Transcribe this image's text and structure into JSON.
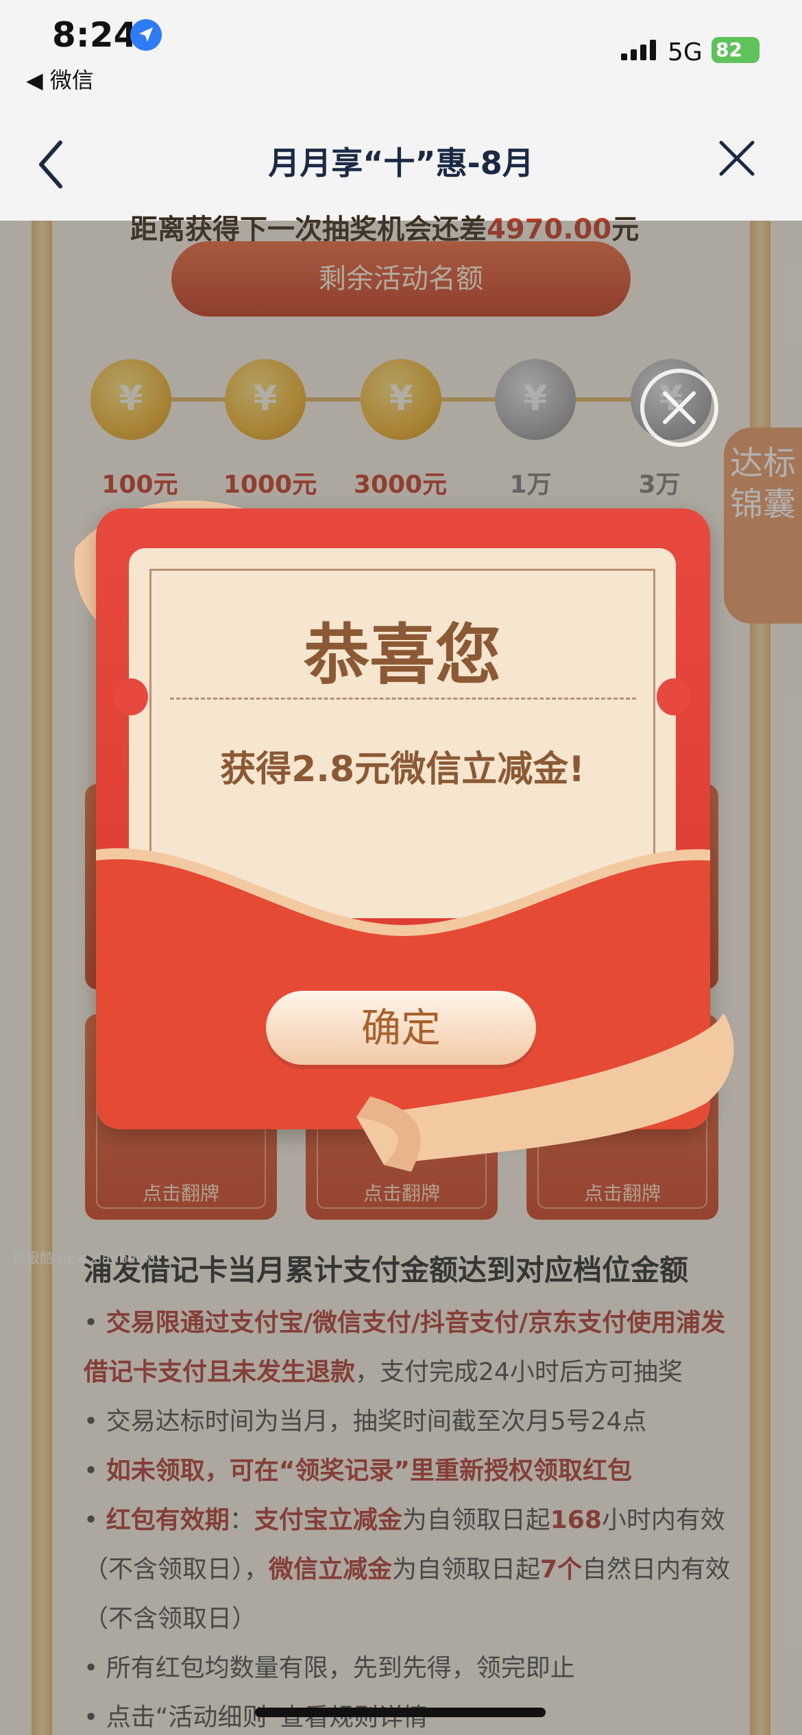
{
  "status_bar": {
    "time": "8:24",
    "back_app": "◀ 微信",
    "network": "5G",
    "battery": "82"
  },
  "nav": {
    "title": "月月享“十”惠-8月"
  },
  "page": {
    "progress_prefix": "距离获得下一次抽奖机会还差",
    "progress_amount": "4970.00",
    "progress_suffix": "元",
    "quota_button": "剩余活动名额",
    "tiers": [
      {
        "label": "100元",
        "state": "gold"
      },
      {
        "label": "1000元",
        "state": "gold"
      },
      {
        "label": "3000元",
        "state": "gold"
      },
      {
        "label": "1万",
        "state": "grey"
      },
      {
        "label": "3万",
        "state": "grey"
      }
    ],
    "side_tab": "达标锦囊",
    "card_label": "点击翻牌",
    "watermark": "线报酷-new.xianbaoku",
    "rules_title": "浦发借记卡当月累计支付金额达到对应档位金额",
    "rules": {
      "r1_bold": "交易限通过支付宝/微信支付/抖音支付/京东支付使用浦发借记卡支付且未发生退款",
      "r1_plain": "，支付完成24小时后方可抽奖",
      "r2": "交易达标时间为当月，抽奖时间截至次月5号24点",
      "r3_bold": "如未领取，可在“领奖记录”里重新授权领取红包",
      "r4_bold_a": "红包有效期",
      "r4_a": "：",
      "r4_bold_b": "支付宝立减金",
      "r4_b": "为自领取日起",
      "r4_bold_c": "168",
      "r4_c": "小时内有效（不含领取日），",
      "r4_bold_d": "微信立减金",
      "r4_d": "为自领取日起",
      "r4_bold_e": "7个",
      "r4_e": "自然日内有效（不含领取日）",
      "r5": "所有红包均数量有限，先到先得，领完即止",
      "r6": "点击“活动细则”查看规则详情"
    }
  },
  "modal": {
    "congrats": "恭喜您",
    "reward": "获得2.8元微信立减金!",
    "confirm": "确定"
  },
  "colors": {
    "packet_red": "#e8493e",
    "ticket_bg": "#f6e6d0",
    "accent_brown": "#8b5a34",
    "nav_title": "#1a2a44"
  }
}
